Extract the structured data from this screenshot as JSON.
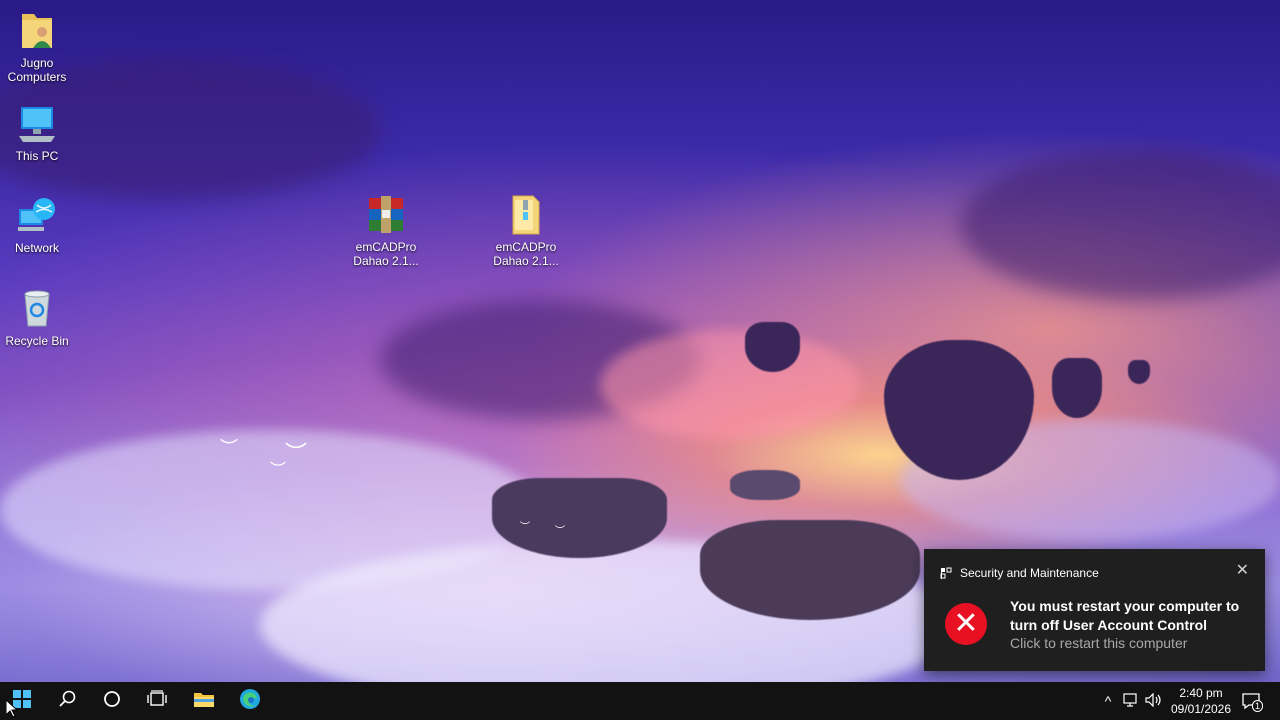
{
  "desktop": {
    "icons": [
      {
        "label": "Jugno\nComputers",
        "icon": "user-folder-icon"
      },
      {
        "label": "This PC",
        "icon": "computer-icon"
      },
      {
        "label": "Network",
        "icon": "network-icon"
      },
      {
        "label": "Recycle Bin",
        "icon": "recycle-bin-icon"
      },
      {
        "label": "emCADPro\nDahao 2.1...",
        "icon": "winrar-archive-icon"
      },
      {
        "label": "emCADPro\nDahao 2.1...",
        "icon": "folder-icon"
      }
    ]
  },
  "toast": {
    "app_name": "Security and Maintenance",
    "close_glyph": "✕",
    "error_glyph": "✕",
    "message": "You must restart your computer to turn off User Account Control",
    "sub": "Click to restart this computer",
    "error_color": "#e81123"
  },
  "taskbar": {
    "tray_chevron": "^",
    "clock_time": "2:40 pm",
    "clock_date": "09/01/2026",
    "notification_count": "1"
  }
}
